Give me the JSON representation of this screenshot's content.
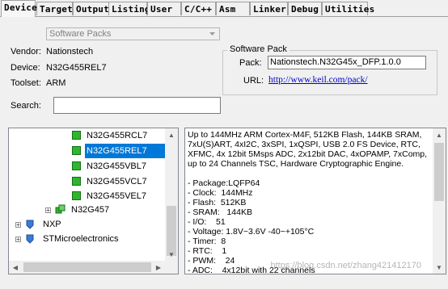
{
  "tabs": [
    "Device",
    "Target",
    "Output",
    "Listing",
    "User",
    "C/C++",
    "Asm",
    "Linker",
    "Debug",
    "Utilities"
  ],
  "device_db": "Software Packs",
  "info": {
    "vendor_label": "Vendor:",
    "vendor": "Nationstech",
    "device_label": "Device:",
    "device": "N32G455REL7",
    "toolset_label": "Toolset:",
    "toolset": "ARM",
    "search_label": "Search:",
    "search_value": ""
  },
  "software_pack": {
    "title": "Software Pack",
    "pack_label": "Pack:",
    "pack": "Nationstech.N32G45x_DFP.1.0.0",
    "url_label": "URL:",
    "url": "http://www.keil.com/pack/"
  },
  "tree": [
    {
      "label": "N32G455RCL7",
      "kind": "device",
      "selected": false
    },
    {
      "label": "N32G455REL7",
      "kind": "device",
      "selected": true
    },
    {
      "label": "N32G455VBL7",
      "kind": "device",
      "selected": false
    },
    {
      "label": "N32G455VCL7",
      "kind": "device",
      "selected": false
    },
    {
      "label": "N32G455VEL7",
      "kind": "device",
      "selected": false
    },
    {
      "label": "N32G457",
      "kind": "family",
      "selected": false
    },
    {
      "label": "NXP",
      "kind": "vendor",
      "selected": false
    },
    {
      "label": "STMicroelectronics",
      "kind": "vendor",
      "selected": false
    }
  ],
  "description": {
    "summary": "Up to 144MHz ARM Cortex-M4F, 512KB Flash, 144KB SRAM, 7xU(S)ART, 4xI2C, 3xSPI, 1xQSPI, USB 2.0 FS Device, RTC, XFMC, 4x 12bit 5Msps ADC, 2x12bit DAC, 4xOPAMP, 7xComp, up to 24 Channels TSC, Hardware Cryptographic Engine.",
    "specs": [
      "- Package:LQFP64",
      "- Clock:  144MHz",
      "- Flash:  512KB",
      "- SRAM:   144KB",
      "- I/O:    51",
      "- Voltage: 1.8V~3.6V -40~+105°C",
      "- Timer:  8",
      "- RTC:    1",
      "- PWM:    24",
      "- ADC:    4x12bit with 22 channels"
    ]
  },
  "watermark": "https://blog.csdn.net/zhang421412170"
}
